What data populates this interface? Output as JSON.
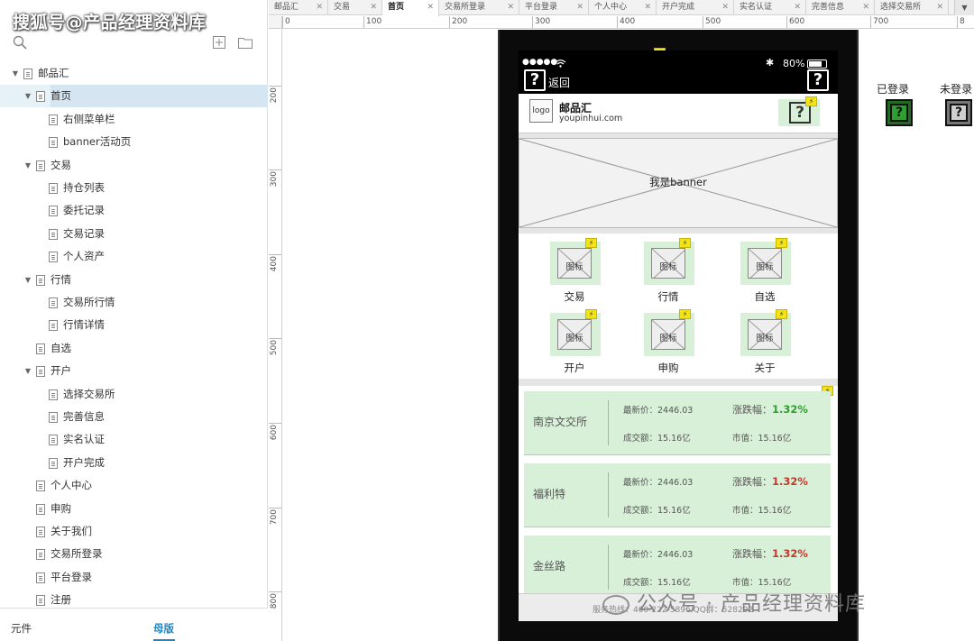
{
  "watermark_top": "搜狐号@产品经理资料库",
  "watermark_bottom": "公众号 · 产品经理资料库",
  "tabs": [
    {
      "label": "邮品汇",
      "active": false
    },
    {
      "label": "交易",
      "active": false
    },
    {
      "label": "首页",
      "active": true
    },
    {
      "label": "交易所登录",
      "active": false
    },
    {
      "label": "平台登录",
      "active": false
    },
    {
      "label": "个人中心",
      "active": false
    },
    {
      "label": "开户完成",
      "active": false
    },
    {
      "label": "实名认证",
      "active": false
    },
    {
      "label": "完善信息",
      "active": false
    },
    {
      "label": "选择交易所",
      "active": false
    }
  ],
  "ruler_h": [
    "0",
    "100",
    "200",
    "300",
    "400",
    "500",
    "600",
    "700",
    "8"
  ],
  "ruler_v": [
    "200",
    "300",
    "400",
    "500",
    "600",
    "700",
    "800"
  ],
  "tree": [
    {
      "label": "邮品汇",
      "level": 0,
      "expanded": true
    },
    {
      "label": "首页",
      "level": 1,
      "expanded": true,
      "selected": true
    },
    {
      "label": "右侧菜单栏",
      "level": 2
    },
    {
      "label": "banner活动页",
      "level": 2
    },
    {
      "label": "交易",
      "level": 1,
      "expanded": true
    },
    {
      "label": "持仓列表",
      "level": 2
    },
    {
      "label": "委托记录",
      "level": 2
    },
    {
      "label": "交易记录",
      "level": 2
    },
    {
      "label": "个人资产",
      "level": 2
    },
    {
      "label": "行情",
      "level": 1,
      "expanded": true
    },
    {
      "label": "交易所行情",
      "level": 2
    },
    {
      "label": "行情详情",
      "level": 2
    },
    {
      "label": "自选",
      "level": 1
    },
    {
      "label": "开户",
      "level": 1,
      "expanded": true
    },
    {
      "label": "选择交易所",
      "level": 2
    },
    {
      "label": "完善信息",
      "level": 2
    },
    {
      "label": "实名认证",
      "level": 2
    },
    {
      "label": "开户完成",
      "level": 2
    },
    {
      "label": "个人中心",
      "level": 1
    },
    {
      "label": "申购",
      "level": 1
    },
    {
      "label": "关于我们",
      "level": 1
    },
    {
      "label": "交易所登录",
      "level": 1
    },
    {
      "label": "平台登录",
      "level": 1
    },
    {
      "label": "注册",
      "level": 1
    }
  ],
  "bottom_tabs": {
    "components": "元件",
    "masters": "母版"
  },
  "phone": {
    "status": {
      "signal": "●●●●●",
      "battery": "80%"
    },
    "back_label": "返回",
    "q_mark": "?",
    "logo_text": "logo",
    "app_name": "邮品汇",
    "app_url": "youpinhui.com",
    "banner_text": "我是banner",
    "icon_placeholder": "图标",
    "grid": [
      "交易",
      "行情",
      "自选",
      "开户",
      "申购",
      "关于"
    ],
    "rows": [
      {
        "name": "南京文交所",
        "price": "最新价：2446.03",
        "volume": "成交额：15.16亿",
        "change_label": "涨跌幅：",
        "change": "1.32%",
        "change_color": "#2e9e2e",
        "cap": "市值：15.16亿"
      },
      {
        "name": "福利特",
        "price": "最新价：2446.03",
        "volume": "成交额：15.16亿",
        "change_label": "涨跌幅：",
        "change": "1.32%",
        "change_color": "#c0392b",
        "cap": "市值：15.16亿"
      },
      {
        "name": "金丝路",
        "price": "最新价：2446.03",
        "volume": "成交额：15.16亿",
        "change_label": "涨跌幅：",
        "change": "1.32%",
        "change_color": "#c0392b",
        "cap": "市值：15.16亿"
      }
    ],
    "footer": "服务热线：400-222-5896  QQ群：528292"
  },
  "states": {
    "logged_in": "已登录",
    "logged_out": "未登录"
  },
  "colors": {
    "accent": "#1b87c9",
    "green_bg": "#d8f0d8",
    "bolt": "#f2e417"
  }
}
